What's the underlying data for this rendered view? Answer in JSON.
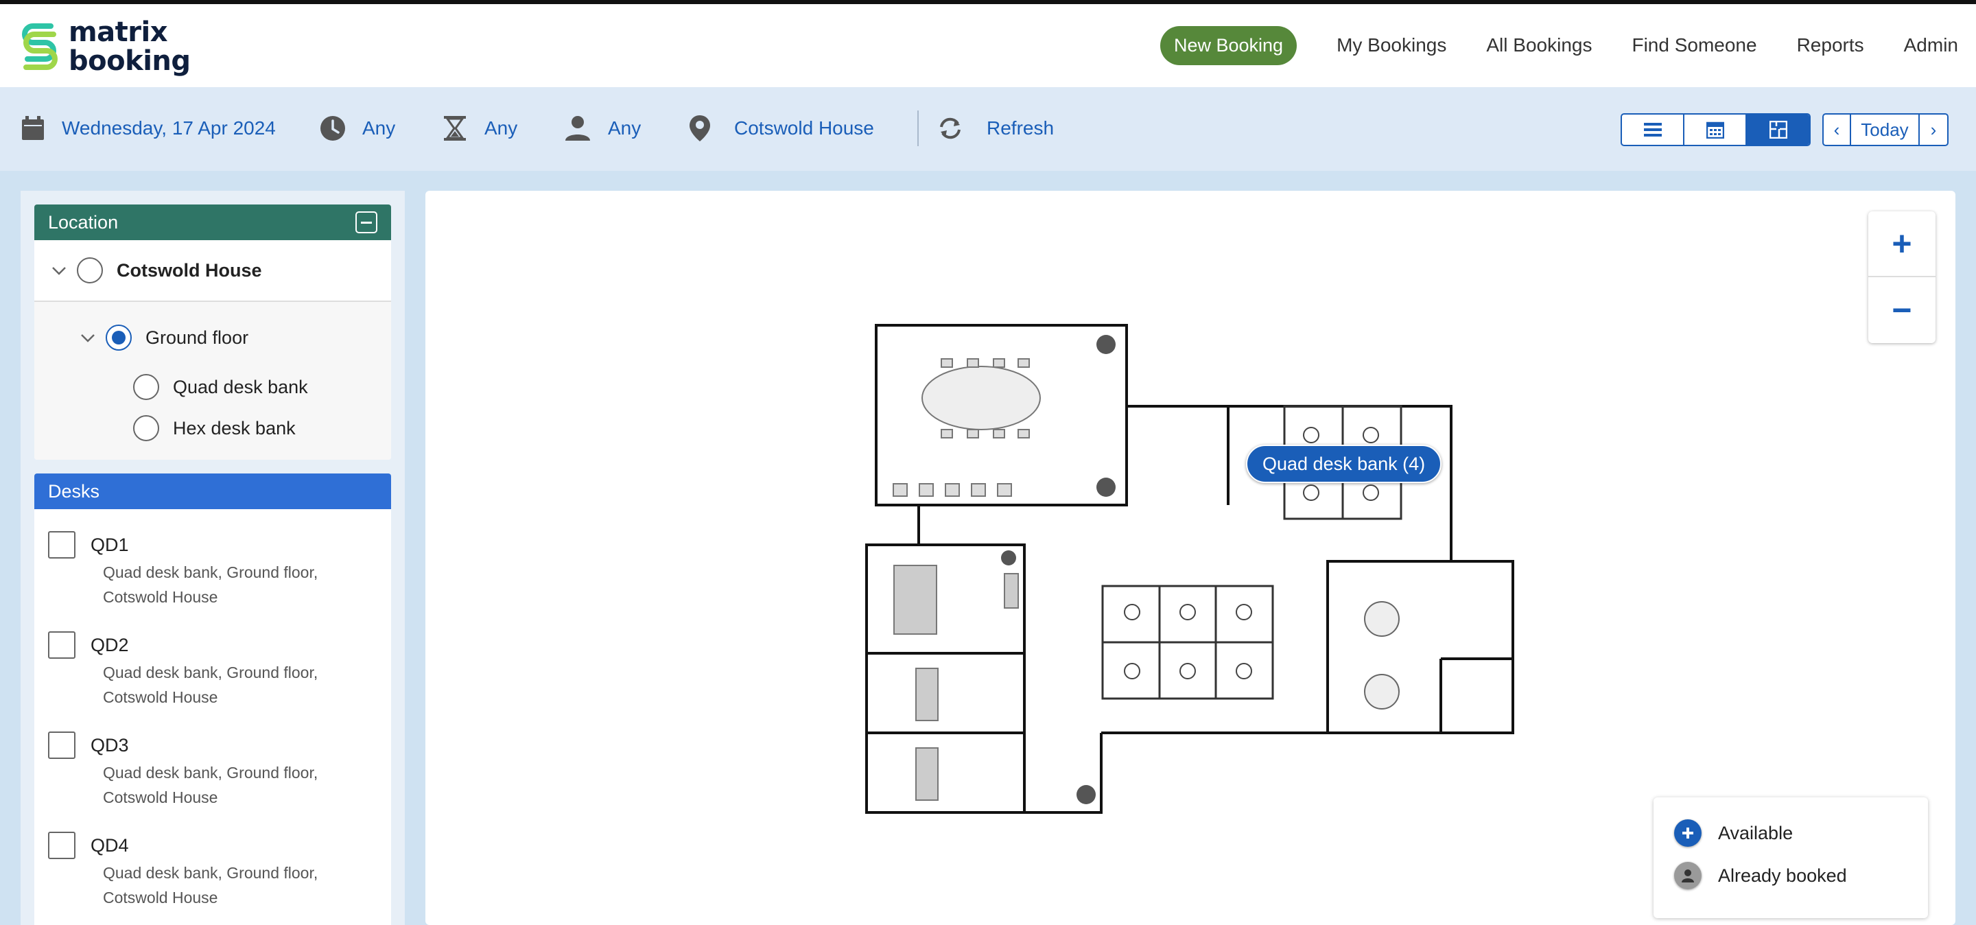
{
  "app": {
    "logo_line1": "matrix",
    "logo_line2": "booking"
  },
  "nav": {
    "new_booking": "New Booking",
    "my_bookings": "My Bookings",
    "all_bookings": "All Bookings",
    "find_someone": "Find Someone",
    "reports": "Reports",
    "admin": "Admin"
  },
  "filters": {
    "date": "Wednesday, 17 Apr 2024",
    "time": "Any",
    "duration": "Any",
    "attendees": "Any",
    "location": "Cotswold House",
    "refresh": "Refresh"
  },
  "date_nav": {
    "prev": "‹",
    "today": "Today",
    "next": "›"
  },
  "location_panel": {
    "title": "Location",
    "building": "Cotswold House",
    "floor": "Ground floor",
    "areas": [
      "Quad desk bank",
      "Hex desk bank"
    ]
  },
  "desks_panel": {
    "title": "Desks",
    "items": [
      {
        "name": "QD1",
        "location": "Quad desk bank, Ground floor, Cotswold House"
      },
      {
        "name": "QD2",
        "location": "Quad desk bank, Ground floor, Cotswold House"
      },
      {
        "name": "QD3",
        "location": "Quad desk bank, Ground floor, Cotswold House"
      },
      {
        "name": "QD4",
        "location": "Quad desk bank, Ground floor, Cotswold House"
      }
    ]
  },
  "map": {
    "zoom_in": "+",
    "zoom_out": "−",
    "bubble": "Quad desk bank (4)",
    "legend": {
      "available": "Available",
      "booked": "Already booked"
    }
  },
  "colors": {
    "primary": "#1a5eb8",
    "nav_green": "#56883a",
    "location_header": "#2f7566",
    "desks_header": "#2f6fd6"
  }
}
